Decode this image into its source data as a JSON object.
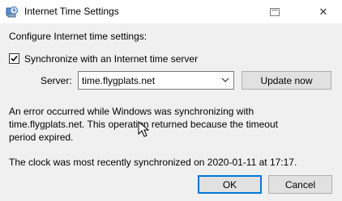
{
  "window": {
    "title": "Internet Time Settings",
    "help_icon": "help-context-icon",
    "close_glyph": "✕"
  },
  "content": {
    "heading": "Configure Internet time settings:",
    "sync_checkbox": {
      "label": "Synchronize with an Internet time server",
      "checked": true
    },
    "server_label": "Server:",
    "server_value": "time.flygplats.net",
    "update_button": "Update now",
    "error_message": "An error occurred while Windows was synchronizing with time.flygplats.net.  This operation returned because the timeout period expired.",
    "last_sync": "The clock was most recently synchronized on 2020-01-11 at 17:17."
  },
  "buttons": {
    "ok": "OK",
    "cancel": "Cancel"
  },
  "colors": {
    "dialog_bg": "#f0f0f0",
    "titlebar_bg": "#ffffff",
    "default_button_border": "#0078d7"
  }
}
